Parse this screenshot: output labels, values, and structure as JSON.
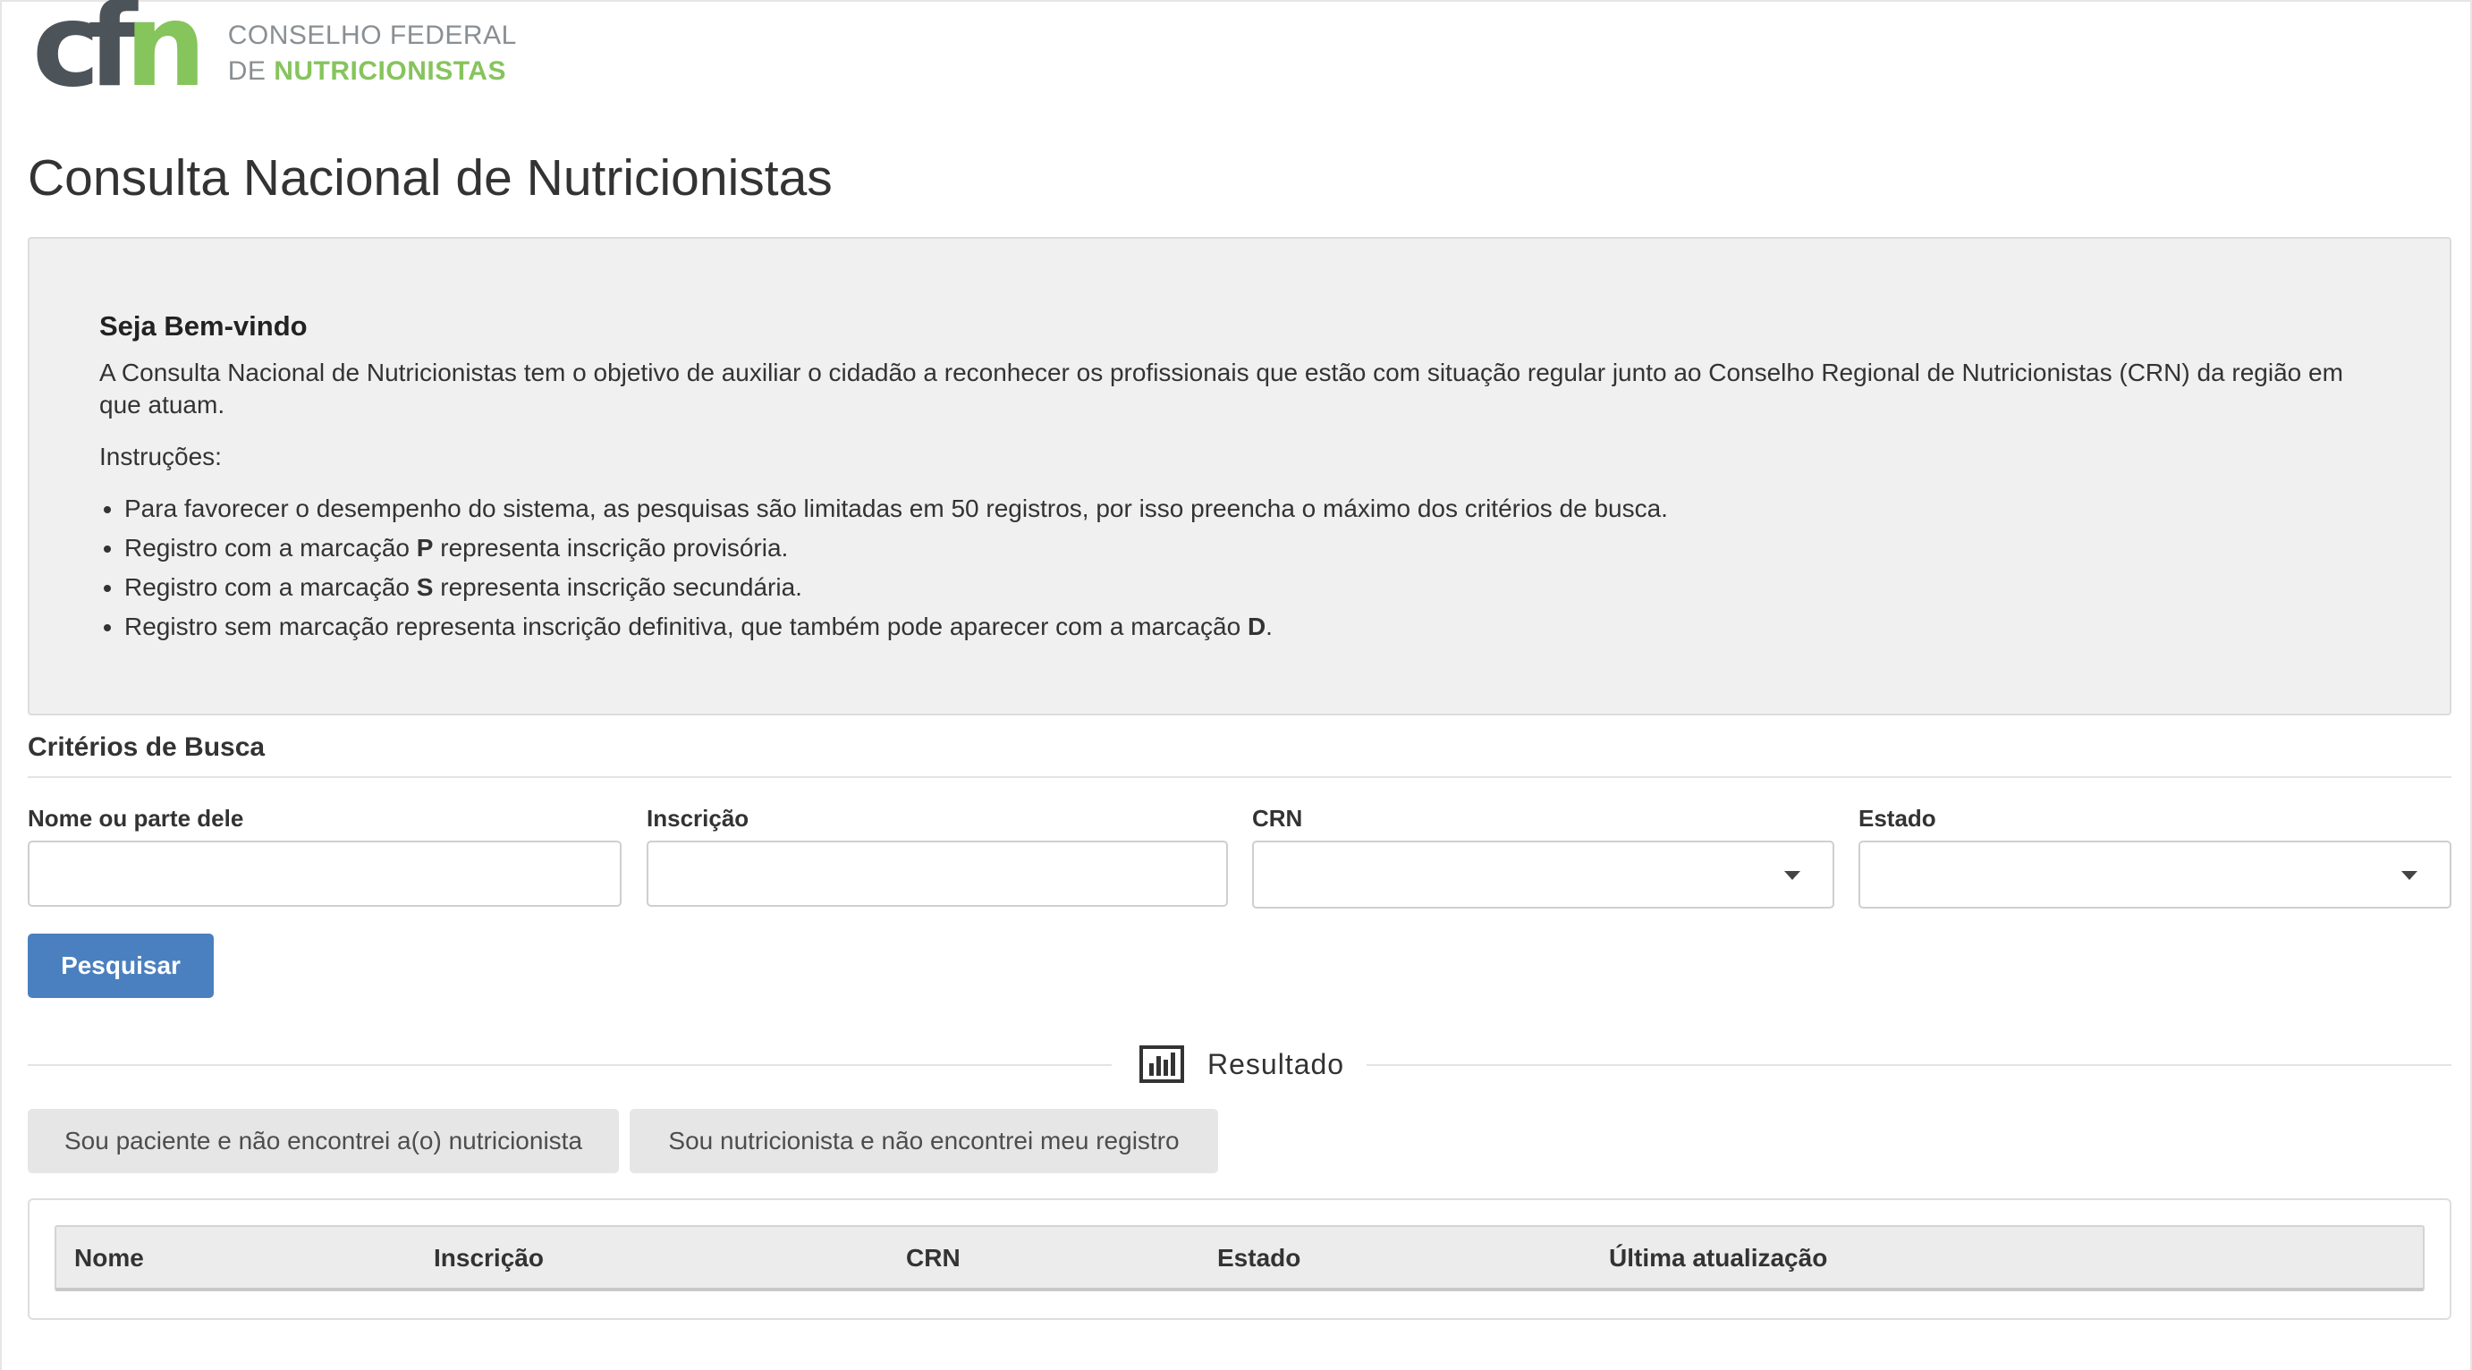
{
  "header": {
    "logo_mark_left": "cf",
    "logo_mark_right": "n",
    "org_line1": "CONSELHO FEDERAL",
    "org_line2_prefix": "DE ",
    "org_line2_bold": "NUTRICIONISTAS"
  },
  "page": {
    "title": "Consulta Nacional de Nutricionistas"
  },
  "welcome": {
    "title": "Seja Bem-vindo",
    "description": "A Consulta Nacional de Nutricionistas tem o objetivo de auxiliar o cidadão a reconhecer os profissionais que estão com situação regular junto ao Conselho Regional de Nutricionistas (CRN) da região em que atuam.",
    "instructions_label": "Instruções:",
    "items": [
      {
        "text": "Para favorecer o desempenho do sistema, as pesquisas são limitadas em 50 registros, por isso preencha o máximo dos critérios de busca.",
        "before": "",
        "mark": "",
        "after": ""
      },
      {
        "before": "Registro com a marcação ",
        "mark": "P",
        "after": " representa inscrição provisória."
      },
      {
        "before": "Registro com a marcação ",
        "mark": "S",
        "after": " representa inscrição secundária."
      },
      {
        "before": "Registro sem marcação representa inscrição definitiva, que também pode aparecer com a marcação ",
        "mark": "D",
        "after": "."
      }
    ]
  },
  "search": {
    "section_title": "Critérios de Busca",
    "name_label": "Nome ou parte dele",
    "name_value": "",
    "inscricao_label": "Inscrição",
    "inscricao_value": "",
    "crn_label": "CRN",
    "crn_selected": "",
    "estado_label": "Estado",
    "estado_selected": "",
    "search_button": "Pesquisar"
  },
  "result": {
    "heading": "Resultado",
    "heading_icon": "bar-chart-icon",
    "patient_button": "Sou paciente e não encontrei a(o) nutricionista",
    "nutritionist_button": "Sou nutricionista e não encontrei meu registro",
    "columns": [
      "Nome",
      "Inscrição",
      "CRN",
      "Estado",
      "Última atualização"
    ],
    "rows": []
  },
  "colors": {
    "primary_button": "#4a80bf",
    "brand_gray": "#4d5459",
    "brand_green": "#86c45c",
    "panel_bg": "#f0f0f0"
  }
}
